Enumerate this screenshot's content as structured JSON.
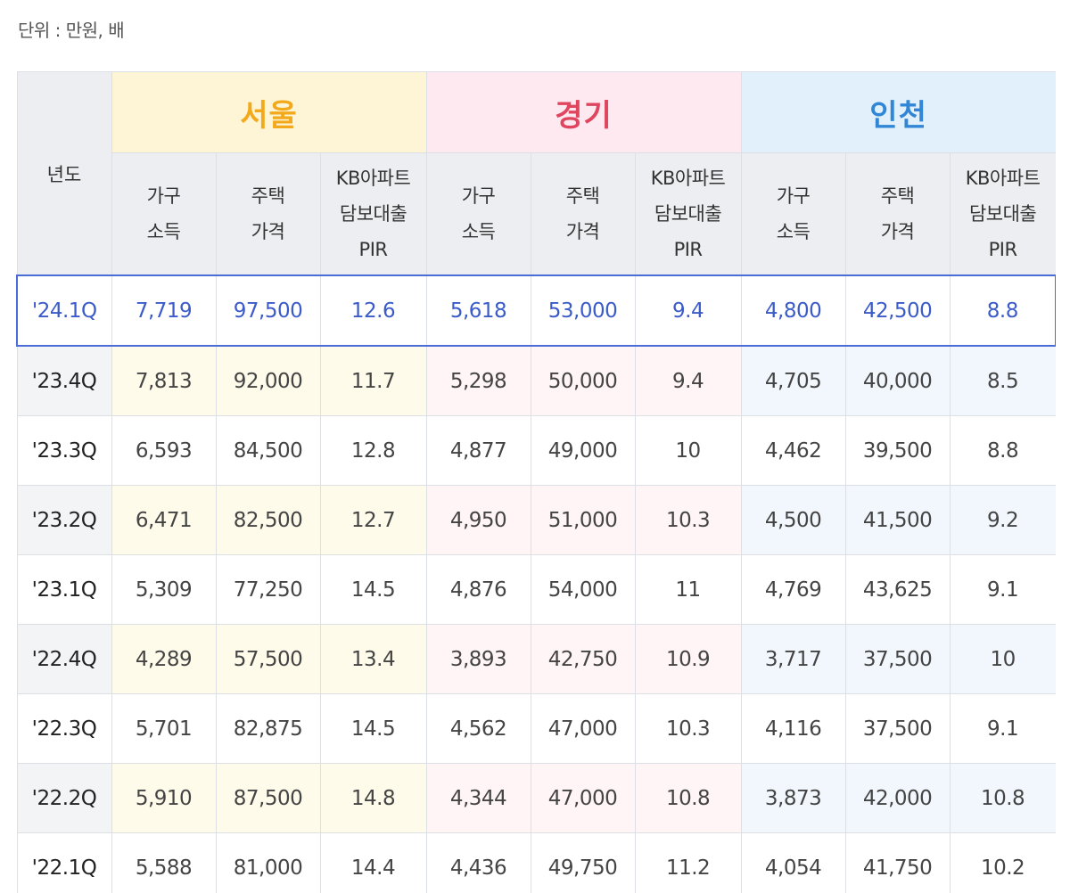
{
  "unit_note": "단위 : 만원, 배",
  "header": {
    "year_label": "년도",
    "regions": [
      "서울",
      "경기",
      "인천"
    ],
    "sub_labels": {
      "income": [
        "가구",
        "소득"
      ],
      "price": [
        "주택",
        "가격"
      ],
      "pir": [
        "KB아파트",
        "담보대출",
        "PIR"
      ]
    }
  },
  "colors": {
    "seoul": "#f3a91c",
    "gyeonggi": "#e0455f",
    "incheon": "#3187d6",
    "highlight": "#3b5bc9"
  },
  "rows": [
    {
      "year": "'24.1Q",
      "values": [
        "7,719",
        "97,500",
        "12.6",
        "5,618",
        "53,000",
        "9.4",
        "4,800",
        "42,500",
        "8.8"
      ]
    },
    {
      "year": "'23.4Q",
      "values": [
        "7,813",
        "92,000",
        "11.7",
        "5,298",
        "50,000",
        "9.4",
        "4,705",
        "40,000",
        "8.5"
      ]
    },
    {
      "year": "'23.3Q",
      "values": [
        "6,593",
        "84,500",
        "12.8",
        "4,877",
        "49,000",
        "10",
        "4,462",
        "39,500",
        "8.8"
      ]
    },
    {
      "year": "'23.2Q",
      "values": [
        "6,471",
        "82,500",
        "12.7",
        "4,950",
        "51,000",
        "10.3",
        "4,500",
        "41,500",
        "9.2"
      ]
    },
    {
      "year": "'23.1Q",
      "values": [
        "5,309",
        "77,250",
        "14.5",
        "4,876",
        "54,000",
        "11",
        "4,769",
        "43,625",
        "9.1"
      ]
    },
    {
      "year": "'22.4Q",
      "values": [
        "4,289",
        "57,500",
        "13.4",
        "3,893",
        "42,750",
        "10.9",
        "3,717",
        "37,500",
        "10"
      ]
    },
    {
      "year": "'22.3Q",
      "values": [
        "5,701",
        "82,875",
        "14.5",
        "4,562",
        "47,000",
        "10.3",
        "4,116",
        "37,500",
        "9.1"
      ]
    },
    {
      "year": "'22.2Q",
      "values": [
        "5,910",
        "87,500",
        "14.8",
        "4,344",
        "47,000",
        "10.8",
        "3,873",
        "42,000",
        "10.8"
      ]
    },
    {
      "year": "'22.1Q",
      "values": [
        "5,588",
        "81,000",
        "14.4",
        "4,436",
        "49,750",
        "11.2",
        "4,054",
        "41,750",
        "10.2"
      ]
    }
  ]
}
